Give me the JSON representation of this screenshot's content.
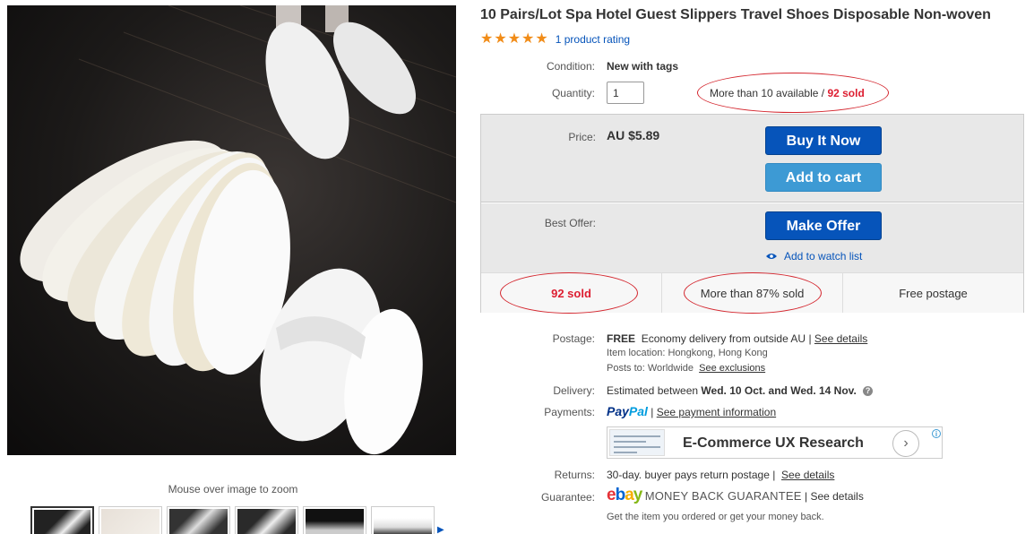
{
  "title": "10 Pairs/Lot Spa Hotel Guest Slippers Travel Shoes Disposable Non-woven",
  "rating": {
    "stars": 5,
    "link": "1 product rating",
    "star_color": "#f18c18"
  },
  "condition": {
    "label": "Condition:",
    "value": "New with tags"
  },
  "quantity": {
    "label": "Quantity:",
    "value": "1",
    "available": "More than 10 available /",
    "sold": "92 sold"
  },
  "price": {
    "label": "Price:",
    "value": "AU $5.89",
    "buy_now": "Buy It Now",
    "add_to_cart": "Add to cart"
  },
  "best_offer": {
    "label": "Best Offer:",
    "make_offer": "Make Offer",
    "watch_list": "Add to watch list"
  },
  "stats": [
    "92 sold",
    "More than 87% sold",
    "Free postage"
  ],
  "postage": {
    "label": "Postage:",
    "free": "FREE",
    "method": "Economy delivery from outside AU",
    "see_details": "See details",
    "item_location": "Item location:  Hongkong, Hong Kong",
    "posts_to": "Posts to:  Worldwide",
    "see_exclusions": "See exclusions"
  },
  "delivery": {
    "label": "Delivery:",
    "text": "Estimated between",
    "range": "Wed. 10 Oct. and Wed. 14 Nov."
  },
  "payments": {
    "label": "Payments:",
    "paypal_1": "Pay",
    "paypal_2": "Pal",
    "link": "See payment information"
  },
  "ad": {
    "text": "E-Commerce UX Research"
  },
  "returns": {
    "label": "Returns:",
    "text": "30-day. buyer pays return postage |",
    "link": "See details"
  },
  "guarantee": {
    "label": "Guarantee:",
    "logo": [
      "e",
      "b",
      "a",
      "y"
    ],
    "mbg": "MONEY BACK GUARANTEE",
    "see_details": "| See details",
    "subtext": "Get the item you ordered or get your money back."
  },
  "zoom_hint": "Mouse over image to zoom",
  "colors": {
    "accent": "#0654ba",
    "secondary_button": "#3d9ad4",
    "highlight_red": "#dd1e31",
    "annotation": "#d4262e"
  }
}
